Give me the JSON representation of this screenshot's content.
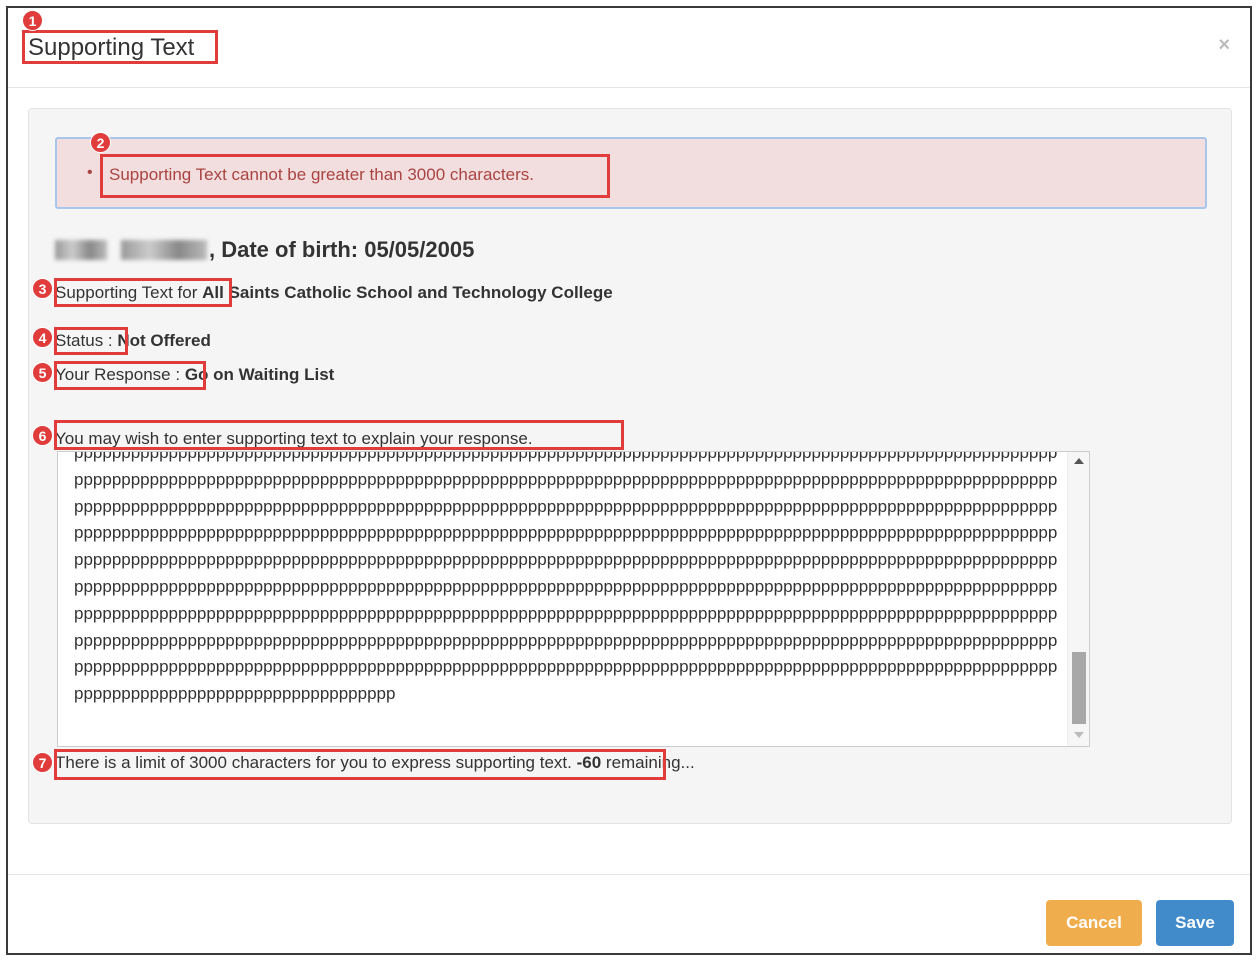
{
  "modal": {
    "title": "Supporting Text",
    "close_glyph": "×"
  },
  "alert": {
    "bullet": "•",
    "message": "Supporting Text cannot be greater than 3000 characters."
  },
  "student": {
    "dob_text": ", Date of birth: 05/05/2005"
  },
  "school": {
    "label": "Supporting Text for",
    "value": "All Saints Catholic School and Technology College"
  },
  "status": {
    "label": "Status :",
    "value": "Not Offered"
  },
  "response": {
    "label": "Your Response :",
    "value": "Go on Waiting List"
  },
  "instructions": "You may wish to enter supporting text to explain your response.",
  "textarea": {
    "value": "pppppppppppppppppppppppppppppppppppppppppppppppppppppppppppppppppppppppppppppppppppppppppppppppppppppppppppppppppppppppppppppppppppppppppppppppppppppppppppppppppppppppppppppppppppppppppppppppppppppppppppppppppppppppppppppppppppppppppppppppppppppppppppppppppppppppppppppppppppppppppppppppppppppppppppppppppppppppppppppppppppppppppppppppppppppppppppppppppppppppppppppppppppppppppppppppppppppppppppppppppppppppppppppppppppppppppppppppppppppppppppppppppppppppppppppppppppppppppppppppppppppppppppppppppppppppppppppppppppppppppppppppppppppppppppppppppppppppppppppppppppppppppppppppppppppppppppppppppppppppppppppppppppppppppppppppppppppppppppppppppppppppppppppppppppppppppppppppppppppppppppppppppppppppppppppppppppppppppppppppppppppppppppppppppppppppppppppppppppppppppppppppppppppppppppppppppppppppppppppppppppppppppppppppppppppppppppppppppppppppppppppppppppppppppppppppppppppppppppppppppppppppppppppppppppppppppppppppppppppppppppppppppppppppppppppppppppppppppppppppppppppppppp"
  },
  "limit": {
    "text": "There is a limit of 3000 characters for you to express supporting text.",
    "remaining_count": "-60",
    "remaining_suffix": "remaining..."
  },
  "buttons": {
    "cancel": "Cancel",
    "save": "Save"
  },
  "annotations": [
    "1",
    "2",
    "3",
    "4",
    "5",
    "6",
    "7"
  ],
  "colors": {
    "alert_bg": "#f2dede",
    "alert_text": "#a94442",
    "cancel_bg": "#f0ad4e",
    "save_bg": "#428bca",
    "annotation_red": "#e03c3c"
  }
}
